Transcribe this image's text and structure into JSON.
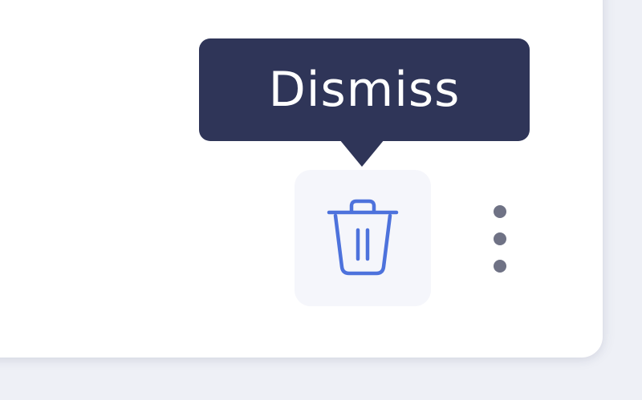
{
  "tooltip": {
    "text": "Dismiss"
  },
  "actions": {
    "delete_icon": "trash-icon",
    "more_icon": "more-vertical-icon"
  },
  "colors": {
    "tooltip_bg": "#2f3558",
    "icon_accent": "#4d72dc",
    "more_dots": "#6f7285",
    "button_bg": "#f5f6fb"
  }
}
